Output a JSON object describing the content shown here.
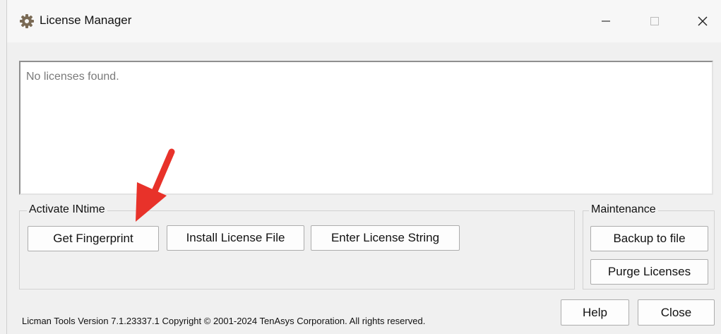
{
  "window": {
    "title": "License Manager",
    "icon": "gear-icon",
    "controls": {
      "minimize": "minimize-icon",
      "maximize": "maximize-icon",
      "close": "close-icon"
    }
  },
  "licenses": {
    "empty_text": "No licenses found."
  },
  "activate": {
    "group_label": "Activate INtime",
    "buttons": {
      "get_fingerprint": "Get Fingerprint",
      "install_license_file": "Install License File",
      "enter_license_string": "Enter License String"
    }
  },
  "maintenance": {
    "group_label": "Maintenance",
    "buttons": {
      "backup": "Backup to file",
      "purge": "Purge Licenses"
    }
  },
  "footer": {
    "version_text": "Licman Tools Version 7.1.23337.1 Copyright © 2001-2024 TenAsys Corporation. All rights reserved.",
    "help_label": "Help",
    "close_label": "Close"
  },
  "annotation": {
    "arrow_color": "#e8322a"
  }
}
